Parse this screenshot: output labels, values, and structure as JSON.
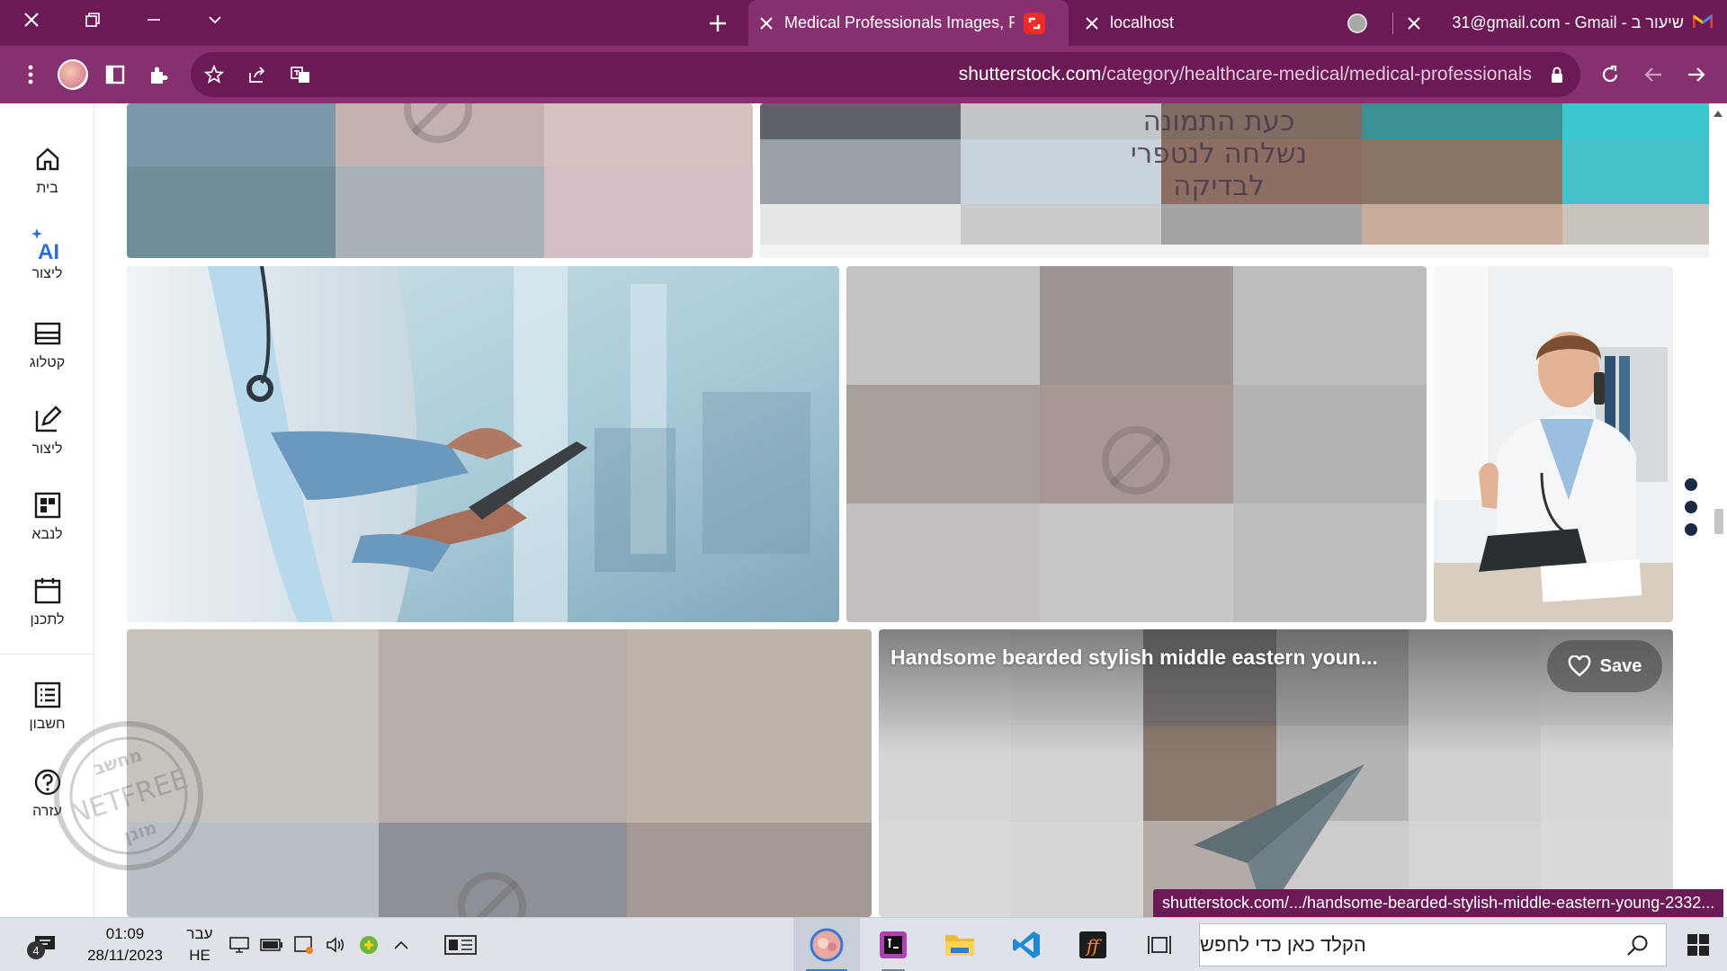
{
  "browser": {
    "tabs": [
      {
        "title": "Medical Professionals Images, Pi",
        "active": true,
        "favicon": "shutterstock-icon"
      },
      {
        "title": "localhost",
        "active": false,
        "favicon": "globe-icon"
      },
      {
        "title": "31@gmail.com - Gmail - שיעור ב",
        "active": false,
        "favicon": "gmail-icon"
      }
    ],
    "url": {
      "host": "shutterstock.com",
      "path": "/category/healthcare-medical/medical-professionals"
    },
    "accent": "#87306f",
    "frame": "#6b1a55"
  },
  "sidebar": {
    "items": [
      {
        "label": "בית",
        "icon": "home-icon"
      },
      {
        "label": "ליצור",
        "icon": "ai-sparkle-icon",
        "badge": "AI"
      },
      {
        "label": "קטלוג",
        "icon": "catalog-icon"
      },
      {
        "label": "ליצור",
        "icon": "edit-icon"
      },
      {
        "label": "לנבא",
        "icon": "grid-icon"
      },
      {
        "label": "לתכנן",
        "icon": "calendar-icon"
      },
      {
        "label": "חשבון",
        "icon": "list-icon"
      },
      {
        "label": "עזרה",
        "icon": "help-icon"
      }
    ]
  },
  "watermark": {
    "brand": "NETFREE",
    "top": "מחשב",
    "bottom": "מוגן"
  },
  "gallery": {
    "blocked_notice": [
      "כעת התמונה",
      "נשלחה לנטפרי",
      "לבדיקה"
    ],
    "hover_tile": {
      "title": "Handsome bearded stylish middle eastern youn...",
      "save_label": "Save"
    }
  },
  "status_bar": {
    "link": "shutterstock.com/.../handsome-bearded-stylish-middle-eastern-young-2332..."
  },
  "taskbar": {
    "time": "01:09",
    "date": "28/11/2023",
    "lang_top": "עבר",
    "lang_bottom": "HE",
    "notifications": "4",
    "search_placeholder": "הקלד כאן כדי לחפש"
  }
}
